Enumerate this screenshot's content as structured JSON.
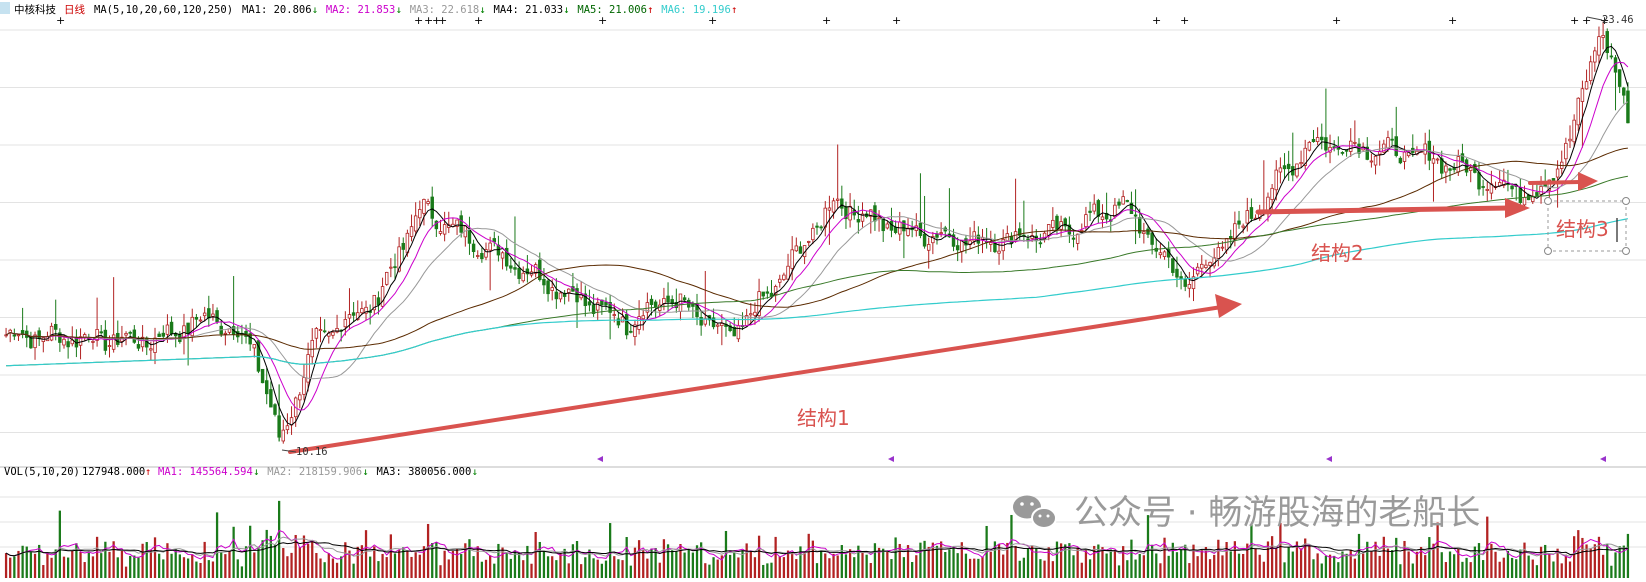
{
  "stock": {
    "name": "中核科技",
    "period": "日线"
  },
  "ma_header": {
    "prefix": "MA(5,10,20,60,120,250)",
    "items": [
      {
        "label": "MA1: 20.806",
        "arrow": "↓",
        "color": "#000000",
        "arrow_color": "#008000"
      },
      {
        "label": "MA2: 21.853",
        "arrow": "↓",
        "color": "#cc00cc",
        "arrow_color": "#008000"
      },
      {
        "label": "MA3: 22.618",
        "arrow": "↓",
        "color": "#999999",
        "arrow_color": "#008000"
      },
      {
        "label": "MA4: 21.033",
        "arrow": "↓",
        "color": "#000000",
        "arrow_color": "#008000"
      },
      {
        "label": "MA5: 21.006",
        "arrow": "↑",
        "color": "#006600",
        "arrow_color": "#cc0000"
      },
      {
        "label": "MA6: 19.196",
        "arrow": "↑",
        "color": "#33cccc",
        "arrow_color": "#cc0000"
      }
    ]
  },
  "vol_header": {
    "prefix": "VOL(5,10,20)",
    "value": "127948.000",
    "value_arrow": "↑",
    "items": [
      {
        "label": "MA1: 145564.594",
        "arrow": "↓",
        "color": "#cc00cc",
        "arrow_color": "#008000"
      },
      {
        "label": "MA2: 218159.906",
        "arrow": "↓",
        "color": "#999999",
        "arrow_color": "#008000"
      },
      {
        "label": "MA3: 380056.000",
        "arrow": "↓",
        "color": "#000000",
        "arrow_color": "#008000"
      }
    ]
  },
  "annotations": {
    "high_label": "23.46",
    "low_label": "10.16",
    "structure_labels": [
      "结构1",
      "结构2",
      "结构3"
    ]
  },
  "watermark": {
    "text": "公众号 · 畅游股海的老船长"
  },
  "colors": {
    "up": "#b22222",
    "down": "#1a7a1a",
    "arrow": "#d9534f",
    "ma5": "#000000",
    "ma10": "#cc00cc",
    "ma20": "#999999",
    "ma60": "#5a2a00",
    "ma120": "#3a7a2a",
    "ma250": "#33cccc",
    "grid": "#c8c8c8"
  },
  "chart_data": {
    "type": "candlestick",
    "title": "中核科技 日线",
    "ylim": [
      9.5,
      23.8
    ],
    "price_waypoints": [
      {
        "day": 0,
        "close": 13.6
      },
      {
        "day": 35,
        "close": 13.4
      },
      {
        "day": 50,
        "close": 14.2
      },
      {
        "day": 60,
        "close": 13.2
      },
      {
        "day": 66,
        "close": 10.16
      },
      {
        "day": 75,
        "close": 13.4
      },
      {
        "day": 90,
        "close": 14.8
      },
      {
        "day": 100,
        "close": 17.7
      },
      {
        "day": 112,
        "close": 16.7
      },
      {
        "day": 135,
        "close": 15.0
      },
      {
        "day": 150,
        "close": 14.0
      },
      {
        "day": 160,
        "close": 14.8
      },
      {
        "day": 175,
        "close": 13.5
      },
      {
        "day": 185,
        "close": 15.0
      },
      {
        "day": 200,
        "close": 17.9
      },
      {
        "day": 215,
        "close": 17.0
      },
      {
        "day": 235,
        "close": 16.6
      },
      {
        "day": 255,
        "close": 16.9
      },
      {
        "day": 270,
        "close": 17.8
      },
      {
        "day": 285,
        "close": 15.2
      },
      {
        "day": 300,
        "close": 17.3
      },
      {
        "day": 315,
        "close": 19.8
      },
      {
        "day": 330,
        "close": 19.6
      },
      {
        "day": 345,
        "close": 19.3
      },
      {
        "day": 360,
        "close": 18.5
      },
      {
        "day": 370,
        "close": 18.1
      },
      {
        "day": 378,
        "close": 19.8
      },
      {
        "day": 385,
        "close": 23.46
      },
      {
        "day": 392,
        "close": 20.8
      }
    ],
    "total_days": 393,
    "volume_scale_max": 1000000
  }
}
